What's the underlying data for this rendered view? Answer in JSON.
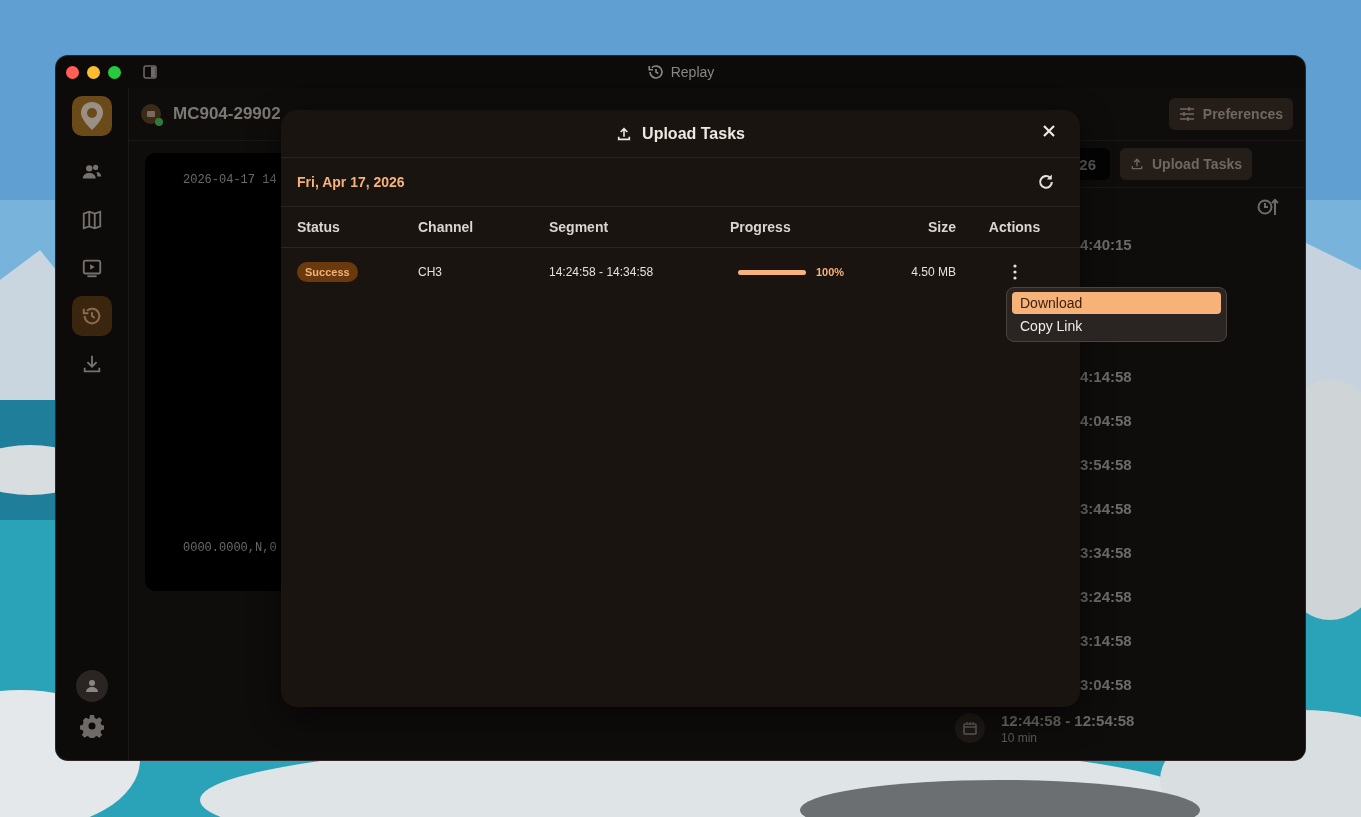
{
  "window": {
    "title": "Replay"
  },
  "sidebar": {
    "items": [
      {
        "kind": "people",
        "selected": false
      },
      {
        "kind": "map",
        "selected": false
      },
      {
        "kind": "play",
        "selected": false
      },
      {
        "kind": "history",
        "selected": true
      },
      {
        "kind": "download",
        "selected": false
      }
    ]
  },
  "header": {
    "title": "MC904-29902",
    "preferences_button": "Preferences"
  },
  "video": {
    "timestamp": "2026-04-17 14",
    "coordinates": "0000.0000,N,0"
  },
  "timeline": {
    "date": "26",
    "upload_button": "Upload Tasks",
    "rows": [
      {
        "time": "4:40:15"
      },
      {
        "time": "4:14:58"
      },
      {
        "time": "4:04:58"
      },
      {
        "time": "3:54:58"
      },
      {
        "time": "3:44:58"
      },
      {
        "time": "3:34:58"
      },
      {
        "time": "3:24:58"
      },
      {
        "time": "3:14:58"
      },
      {
        "time": "3:04:58"
      },
      {
        "time": "12:44:58 - 12:54:58",
        "duration": "10 min"
      }
    ]
  },
  "modal": {
    "title": "Upload Tasks",
    "date": "Fri, Apr 17, 2026",
    "columns": [
      "Status",
      "Channel",
      "Segment",
      "Progress",
      "Size",
      "Actions"
    ],
    "rows": [
      {
        "status": "Success",
        "channel": "CH3",
        "segment": "14:24:58 - 14:34:58",
        "level": 1,
        "progress": "100%",
        "size": "4.50 MB"
      }
    ]
  },
  "menu": {
    "items": [
      {
        "label": "Download",
        "selected": true
      },
      {
        "label": "Copy Link",
        "selected": false
      }
    ]
  }
}
